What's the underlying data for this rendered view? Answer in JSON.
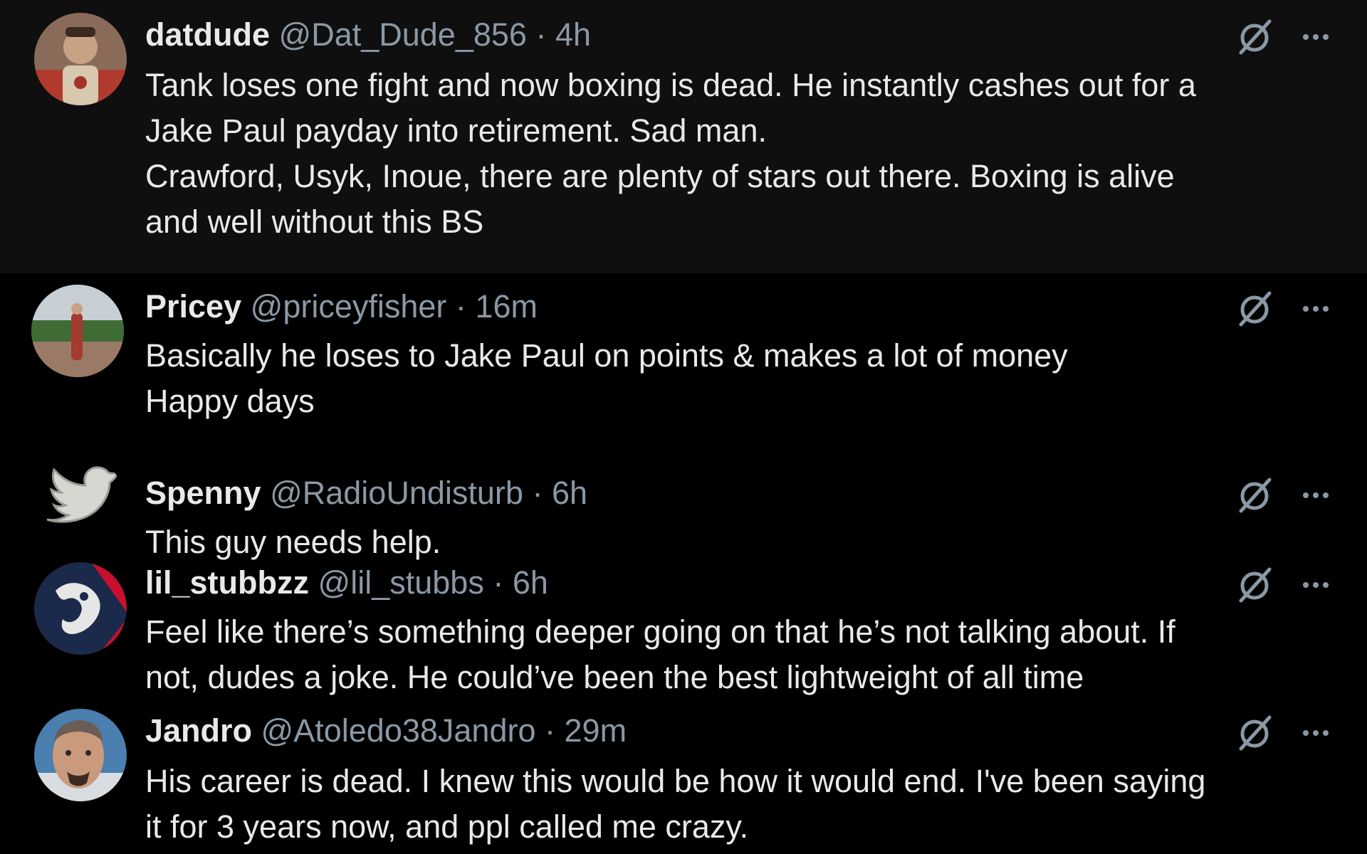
{
  "tweets": [
    {
      "name": "datdude",
      "handle": "@Dat_Dude_856",
      "sep": "·",
      "time": "4h",
      "lines": [
        "Tank loses one fight and now boxing is dead. He instantly cashes out for a",
        "Jake Paul payday into retirement. Sad man.",
        "Crawford, Usyk, Inoue, there are plenty of stars out there. Boxing is alive",
        "and well without this BS"
      ],
      "avatar_icon": "profile-photo-avatar"
    },
    {
      "name": "Pricey",
      "handle": "@priceyfisher",
      "sep": "·",
      "time": "16m",
      "lines": [
        "Basically he loses to Jake Paul on points & makes a lot of money",
        "Happy days"
      ],
      "avatar_icon": "profile-photo-avatar"
    },
    {
      "name": "Spenny",
      "handle": "@RadioUndisturb",
      "sep": "·",
      "time": "6h",
      "lines": [
        "This guy needs help."
      ],
      "avatar_icon": "bird-logo-avatar"
    },
    {
      "name": "lil_stubbzz",
      "handle": "@lil_stubbs",
      "sep": "·",
      "time": "6h",
      "lines": [
        "Feel like there’s something deeper going on that he’s not talking about. If",
        "not, dudes a joke. He could’ve been the best lightweight of all time"
      ],
      "avatar_icon": "logo-avatar"
    },
    {
      "name": "Jandro",
      "handle": "@Atoledo38Jandro",
      "sep": "·",
      "time": "29m",
      "lines": [
        "His career is dead. I knew this would be how it would end. I've been saying",
        "it for 3 years now, and ppl called me crazy."
      ],
      "avatar_icon": "profile-photo-avatar"
    }
  ],
  "icons": {
    "grok": "grok-icon",
    "more": "more-options-icon"
  },
  "colors": {
    "background": "#000000",
    "highlight_background": "#0f0f0f",
    "text": "#e7e9ea",
    "secondary_text": "#8b98a5"
  }
}
